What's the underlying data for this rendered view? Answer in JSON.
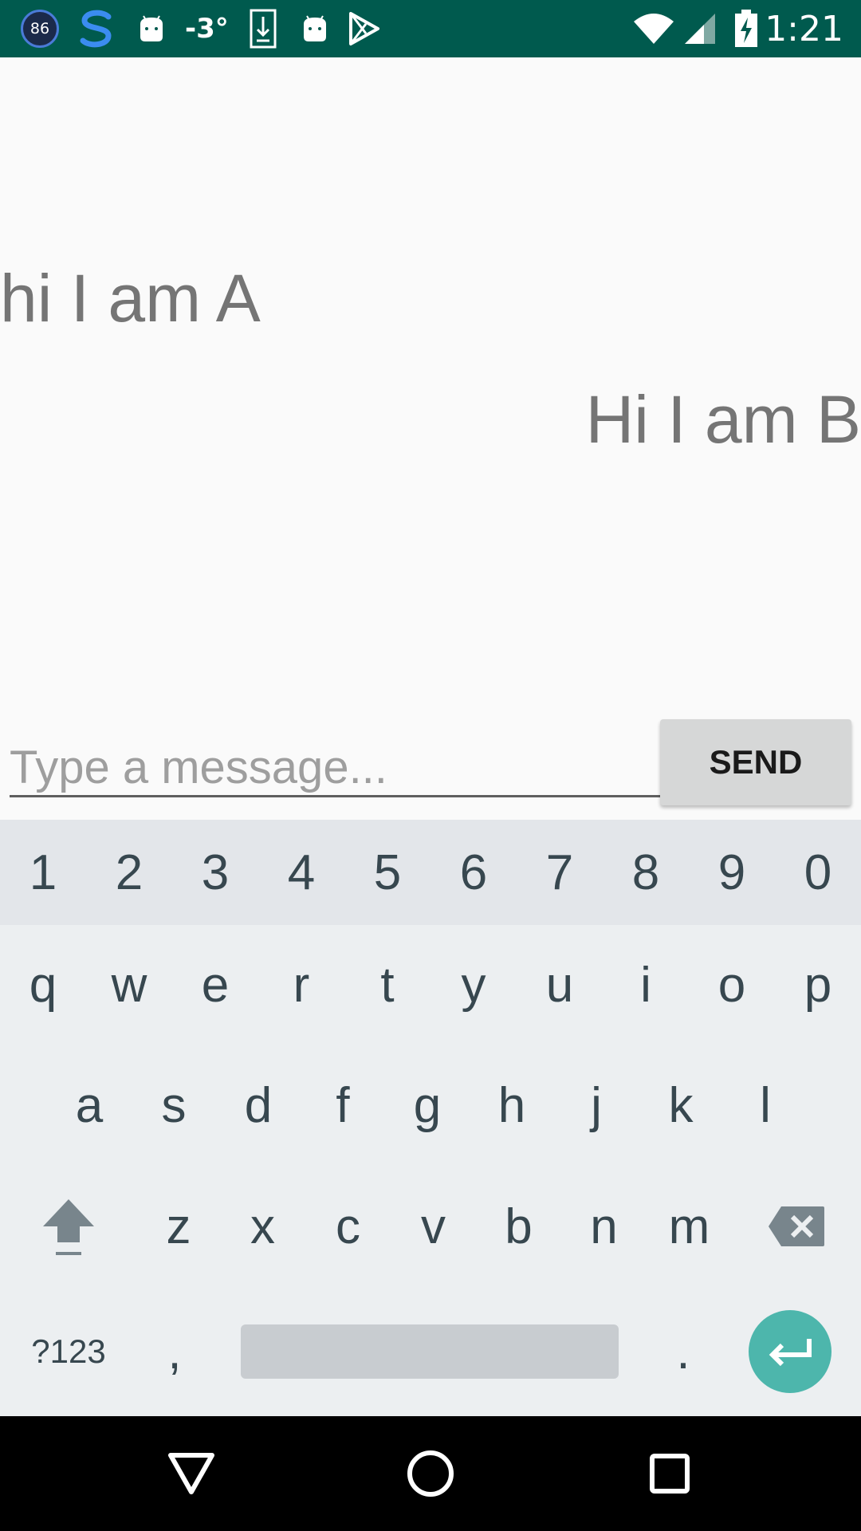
{
  "status_bar": {
    "badge_number": "86",
    "temperature": "-3°",
    "time": "1:21",
    "icons": [
      "speed-badge-icon",
      "s-app-icon",
      "android-icon",
      "download-icon",
      "android-icon",
      "play-store-icon",
      "wifi-icon",
      "signal-icon",
      "battery-charging-icon"
    ]
  },
  "messages": [
    {
      "text": "hi I am A",
      "side": "left"
    },
    {
      "text": "Hi I am B",
      "side": "right"
    }
  ],
  "composer": {
    "placeholder": "Type a message...",
    "value": "",
    "send_label": "SEND"
  },
  "keyboard": {
    "numbers": [
      "1",
      "2",
      "3",
      "4",
      "5",
      "6",
      "7",
      "8",
      "9",
      "0"
    ],
    "row_q": [
      "q",
      "w",
      "e",
      "r",
      "t",
      "y",
      "u",
      "i",
      "o",
      "p"
    ],
    "row_a": [
      "a",
      "s",
      "d",
      "f",
      "g",
      "h",
      "j",
      "k",
      "l"
    ],
    "row_z": [
      "z",
      "x",
      "c",
      "v",
      "b",
      "n",
      "m"
    ],
    "symbols_label": "?123",
    "comma": ",",
    "period": ".",
    "accent_color": "#4db6ac"
  },
  "nav_bar": {
    "icons": [
      "back-icon",
      "home-icon",
      "recents-icon"
    ]
  },
  "colors": {
    "status_bar": "#005a4e",
    "message_text": "#757575"
  }
}
